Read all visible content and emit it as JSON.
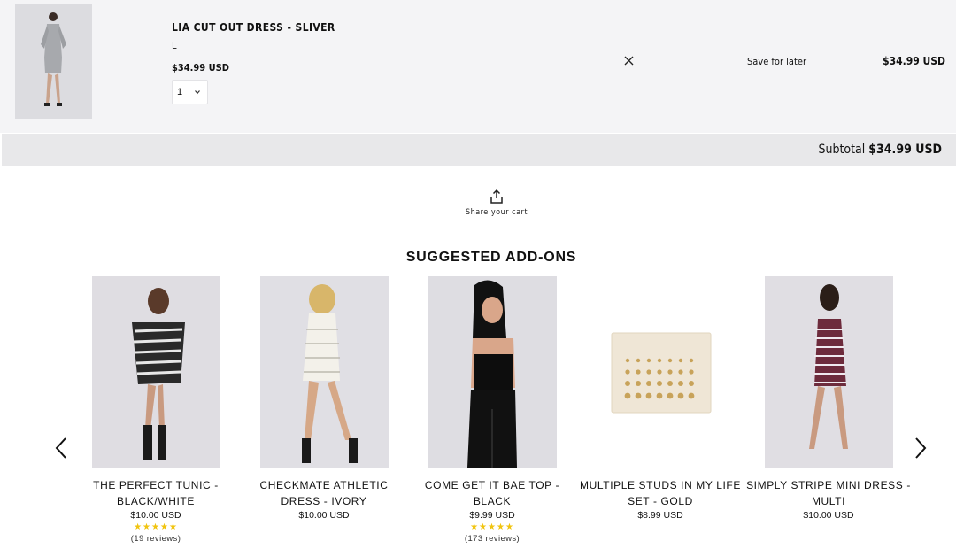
{
  "cart": {
    "item": {
      "name": "LIA CUT OUT DRESS - SLIVER",
      "size": "L",
      "price": "$34.99 USD",
      "quantity": "1",
      "save_label": "Save for later",
      "line_total": "$34.99 USD"
    },
    "subtotal_label": "Subtotal",
    "subtotal_value": "$34.99 USD"
  },
  "share": {
    "label": "Share your cart"
  },
  "addons": {
    "title": "SUGGESTED ADD-ONS",
    "products": [
      {
        "name": "THE PERFECT TUNIC - BLACK/WHITE",
        "price": "$10.00 USD",
        "stars": "★★★★★",
        "reviews": "(19 reviews)"
      },
      {
        "name": "CHECKMATE ATHLETIC DRESS - IVORY",
        "price": "$10.00 USD",
        "stars": "",
        "reviews": ""
      },
      {
        "name": "COME GET IT BAE TOP - BLACK",
        "price": "$9.99 USD",
        "stars": "★★★★★",
        "reviews": "(173 reviews)"
      },
      {
        "name": "MULTIPLE STUDS IN MY LIFE SET - GOLD",
        "price": "$8.99 USD",
        "stars": "",
        "reviews": ""
      },
      {
        "name": "SIMPLY STRIPE MINI DRESS - MULTI",
        "price": "$10.00 USD",
        "stars": "",
        "reviews": ""
      }
    ]
  },
  "colors": {
    "cart_bg": "#f4f4f6",
    "subtotal_bg": "#e8e8ea",
    "star": "#f1c40f"
  }
}
